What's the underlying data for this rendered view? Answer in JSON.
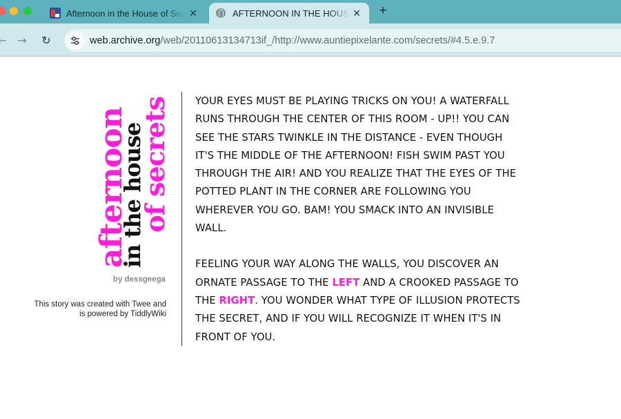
{
  "browser": {
    "tabs": [
      {
        "title": "Afternoon in the House of Secrets",
        "favicon": "interactive-fiction-icon",
        "active": false
      },
      {
        "title": "AFTERNOON IN THE HOUSE OF SECRETS",
        "favicon": "globe-icon",
        "active": true
      }
    ],
    "close_glyph": "✕",
    "new_tab_glyph": "+",
    "url_host": "web.archive.org",
    "url_path": "/web/20110613134713if_/http://www.auntiepixelante.com/secrets/#4.5.e.9.7",
    "icons": {
      "back": "←",
      "forward": "→",
      "reload": "↻"
    },
    "colors": {
      "tabbar": "#5eb2bd",
      "toolbar": "#cfe9ec"
    }
  },
  "page": {
    "logo": {
      "line1": "afternoon",
      "line2": "in the house",
      "line3": "of secrets"
    },
    "byline": "by dessgeega",
    "credits": "This story was created with Twee and is powered by TiddlyWiki",
    "story": {
      "paragraph1_lines": [
        "YOUR EYES MUST BE PLAYING TRICKS ON YOU! A WATERFALL",
        "RUNS THROUGH THE CENTER OF THIS ROOM - UP!! YOU CAN",
        "SEE THE STARS TWINKLE IN THE DISTANCE - EVEN THOUGH",
        "IT'S THE MIDDLE OF THE AFTERNOON! FISH SWIM PAST YOU",
        "THROUGH THE AIR! AND YOU REALIZE THAT THE EYES OF THE",
        "POTTED PLANT IN THE CORNER ARE FOLLOWING YOU",
        "WHEREVER YOU GO. BAM! YOU SMACK INTO AN INVISIBLE",
        "WALL."
      ],
      "p2_l1": "FEELING YOUR WAY ALONG THE WALLS, YOU DISCOVER AN",
      "p2_l2_pre": "ORNATE PASSAGE TO THE ",
      "link_left": "LEFT",
      "p2_l2_post": " AND A CROOKED PASSAGE TO",
      "p2_l3_pre": "THE ",
      "link_right": "RIGHT",
      "p2_l3_post": ". YOU WONDER WHAT TYPE OF ILLUSION PROTECTS",
      "p2_l4": "THE SECRET, AND IF YOU WILL RECOGNIZE IT WHEN IT'S IN",
      "p2_l5": "FRONT OF YOU."
    },
    "colors": {
      "accent": "#ff1fd8",
      "text": "#111111"
    }
  }
}
